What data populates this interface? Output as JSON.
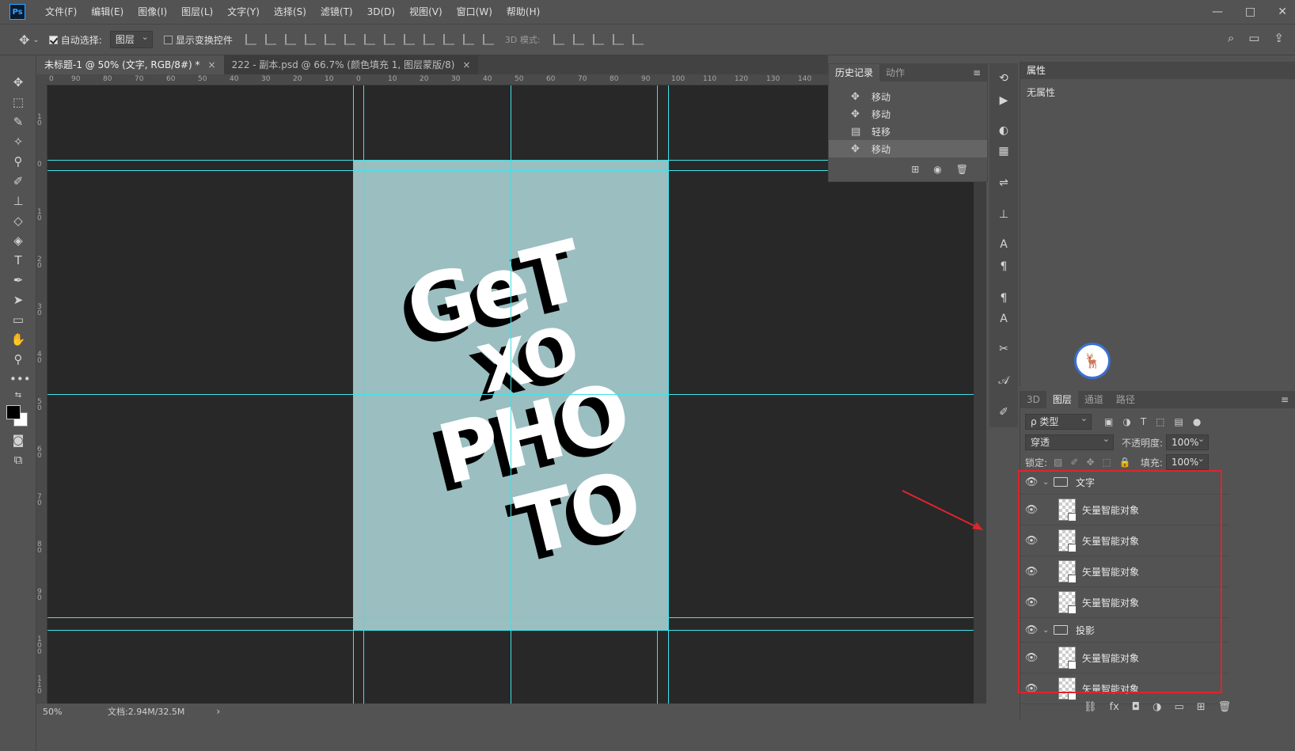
{
  "app": {
    "logo": "Ps"
  },
  "menu": [
    "文件(F)",
    "编辑(E)",
    "图像(I)",
    "图层(L)",
    "文字(Y)",
    "选择(S)",
    "滤镜(T)",
    "3D(D)",
    "视图(V)",
    "窗口(W)",
    "帮助(H)"
  ],
  "window_controls": {
    "minimize": "—",
    "restore": "□",
    "close": "✕"
  },
  "options": {
    "auto_select_label": "自动选择:",
    "auto_select_checked": true,
    "auto_select_target": "图层",
    "show_transform_label": "显示变换控件",
    "show_transform_checked": false,
    "mode_3d": "3D 模式:"
  },
  "tabs": [
    {
      "label": "未标题-1 @ 50% (文字, RGB/8#) *",
      "active": true,
      "close": "×"
    },
    {
      "label": "222 - 副本.psd @ 66.7% (颜色填充 1, 图层蒙版/8)",
      "active": false,
      "close": "×"
    }
  ],
  "ruler_h": [
    "0",
    "90",
    "80",
    "70",
    "60",
    "50",
    "40",
    "30",
    "20",
    "10",
    "0",
    "10",
    "20",
    "30",
    "40",
    "50",
    "60",
    "70",
    "80",
    "90",
    "100",
    "110",
    "120",
    "130",
    "140"
  ],
  "ruler_v": [
    "1 0",
    "0",
    "1 0",
    "2 0",
    "3 0",
    "4 0",
    "5 0",
    "6 0",
    "7 0",
    "8 0",
    "9 0",
    "1 0 0",
    "1 1 0"
  ],
  "artwork": {
    "lines": [
      "GeT",
      "XO",
      "PHO",
      "TO"
    ],
    "background": "#9bbec0",
    "text_color": "#ffffff",
    "shadow_color": "#000000"
  },
  "status": {
    "zoom": "50%",
    "doc": "文档:2.94M/32.5M",
    "arrow": "›"
  },
  "history_panel": {
    "tabs": [
      "历史记录",
      "动作"
    ],
    "items": [
      {
        "icon": "move-icon",
        "label": "移动",
        "selected": false
      },
      {
        "icon": "move-icon",
        "label": "移动",
        "selected": false
      },
      {
        "icon": "nudge-icon",
        "label": "轻移",
        "selected": false
      },
      {
        "icon": "move-icon",
        "label": "移动",
        "selected": true
      }
    ]
  },
  "properties_panel": {
    "title": "属性",
    "body": "无属性",
    "badge_glyph": "🦌"
  },
  "layers_panel": {
    "tabs": [
      "3D",
      "图层",
      "通道",
      "路径"
    ],
    "active_tab": "图层",
    "filter_label": "ρ 类型",
    "blend_mode": "穿透",
    "opacity_label": "不透明度:",
    "opacity": "100%",
    "lock_label": "锁定:",
    "fill_label": "填充:",
    "fill": "100%",
    "layers": [
      {
        "type": "group",
        "name": "文字"
      },
      {
        "type": "layer",
        "name": "矢量智能对象"
      },
      {
        "type": "layer",
        "name": "矢量智能对象"
      },
      {
        "type": "layer",
        "name": "矢量智能对象"
      },
      {
        "type": "layer",
        "name": "矢量智能对象"
      },
      {
        "type": "group",
        "name": "投影"
      },
      {
        "type": "layer",
        "name": "矢量智能对象"
      },
      {
        "type": "layer",
        "name": "矢量智能对象"
      }
    ],
    "footer_icons": [
      "link-icon",
      "fx-icon",
      "mask-icon",
      "adjustment-icon",
      "folder-icon",
      "new-layer-icon",
      "trash-icon"
    ]
  },
  "colors": {
    "accent_guide": "#3fe2e8",
    "highlight": "#e0242c",
    "ui_bg": "#535353",
    "canvas_bg": "#282828"
  }
}
